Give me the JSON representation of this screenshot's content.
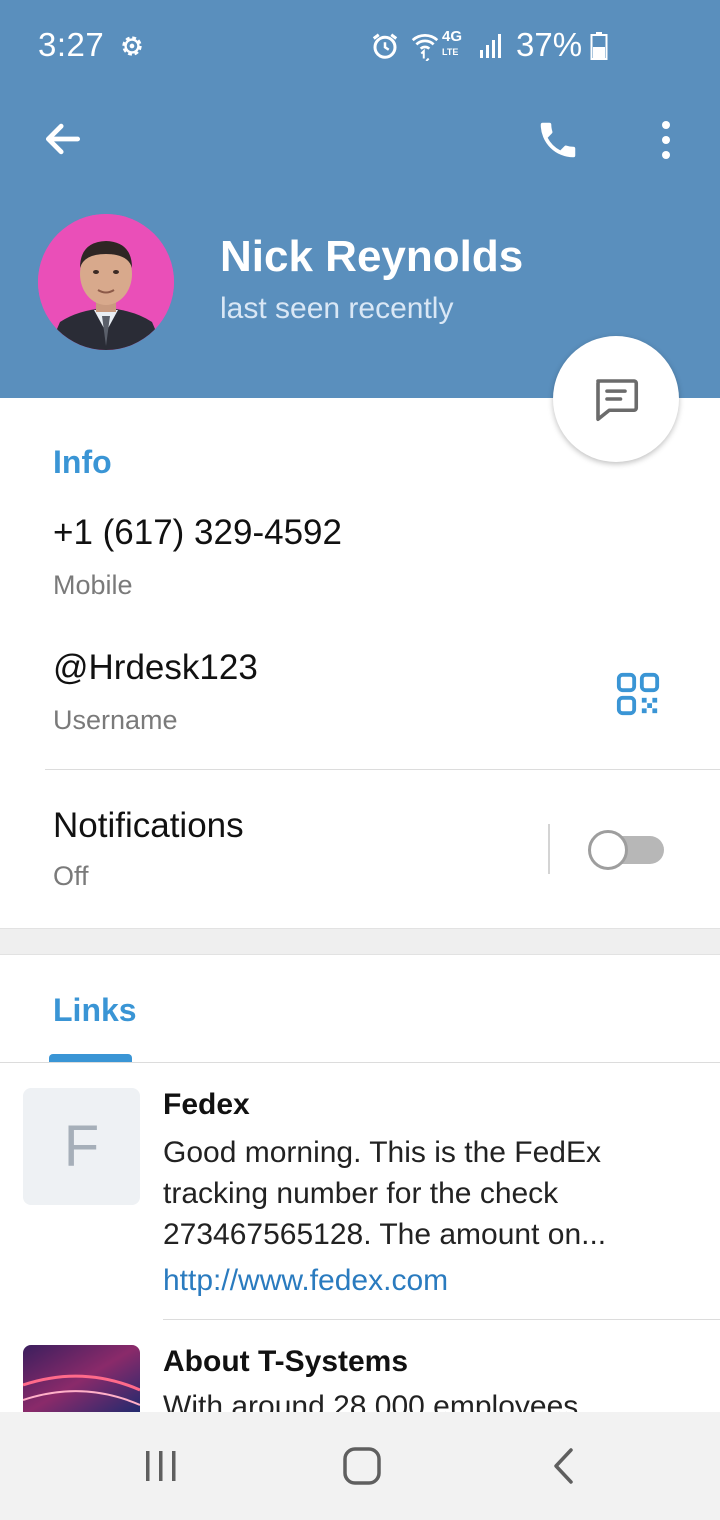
{
  "status_bar": {
    "time": "3:27",
    "network": "4G",
    "network_sub": "LTE",
    "battery_percent": "37%"
  },
  "header": {
    "name": "Nick Reynolds",
    "status": "last seen recently"
  },
  "info": {
    "title": "Info",
    "phone": "+1 (617) 329-4592",
    "phone_label": "Mobile",
    "username": "@Hrdesk123",
    "username_label": "Username",
    "notifications_label": "Notifications",
    "notifications_value": "Off",
    "notifications_enabled": false
  },
  "links": {
    "tab_title": "Links",
    "items": [
      {
        "thumb_letter": "F",
        "title": "Fedex",
        "description": "Good morning. This is the FedEx tracking number for the check 273467565128. The amount on...",
        "url": "http://www.fedex.com"
      },
      {
        "title": "About T-Systems",
        "description": "With around 28,000 employees"
      }
    ]
  },
  "colors": {
    "header_bg": "#5a8fbd",
    "accent": "#3a95d5",
    "link": "#2a7bbf",
    "avatar_bg": "#ea4fb8"
  },
  "icons": [
    "settings-gear-icon",
    "alarm-icon",
    "wifi-icon",
    "signal-icon",
    "battery-icon",
    "back-arrow-icon",
    "phone-icon",
    "more-vertical-icon",
    "message-icon",
    "qr-code-icon",
    "recents-icon",
    "home-icon",
    "nav-back-icon"
  ]
}
